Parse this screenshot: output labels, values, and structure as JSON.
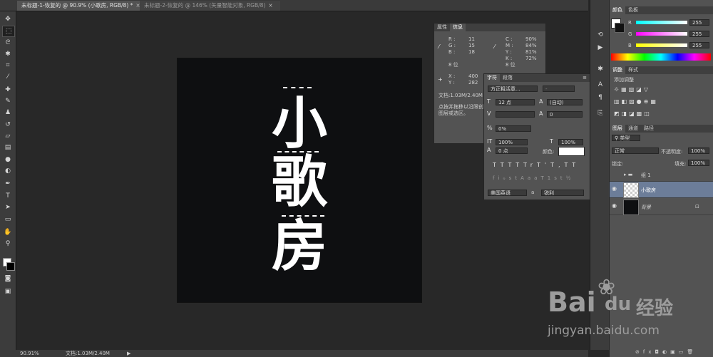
{
  "tabs": [
    {
      "label": "未标题-1-恢复的 @ 90.9% (小歌房, RGB/8) *",
      "close": "×"
    },
    {
      "label": "未标题-2-恢复的 @ 146% (矢量智能对象, RGB/8)",
      "close": "×"
    }
  ],
  "canvas_text": {
    "line1": "小",
    "line2": "歌",
    "line3": "房"
  },
  "status": {
    "zoom": "90.91%",
    "doc": "文档:1.03M/2.40M"
  },
  "info_panel": {
    "tabs": [
      "属性",
      "信息"
    ],
    "r_label": "R :",
    "r_val": "11",
    "g_label": "G :",
    "g_val": "15",
    "b_label": "B :",
    "b_val": "18",
    "c_label": "C :",
    "c_val": "90%",
    "m_label": "M :",
    "m_val": "84%",
    "y_label": "Y :",
    "y_val": "81%",
    "k_label": "K :",
    "k_val": "72%",
    "bits1": "8 位",
    "bits2": "8 位",
    "x_label": "X :",
    "x_val": "400",
    "y2_label": "Y :",
    "y2_val": "282",
    "doc": "文档:1.03M/2.40M",
    "hint": "点按并拖移以沿限创建图层或选区。"
  },
  "char_panel": {
    "tabs": [
      "字符",
      "段落"
    ],
    "font": "方正粗活意...",
    "style": "-",
    "size": "12 点",
    "leading": "(自动)",
    "tracking": "0",
    "scale_pct": "0%",
    "vscale": "100%",
    "hscale": "100%",
    "baseline": "0 点",
    "color_label": "颜色:",
    "lang": "美国英语",
    "aa_label": "a",
    "aa": "锐利",
    "glyphs1": [
      "T",
      "T",
      "TT",
      "Tr",
      "T'",
      "T,",
      "T",
      "T"
    ],
    "glyphs2": [
      "fi",
      "ℴ",
      "st",
      "A",
      "aa",
      "T",
      "1st",
      "½"
    ]
  },
  "color_panel": {
    "tabs": [
      "颜色",
      "色板"
    ],
    "r_label": "R",
    "r_val": "255",
    "g_label": "G",
    "g_val": "255",
    "b_label": "B",
    "b_val": "255"
  },
  "adjust_panel": {
    "tabs": [
      "调整",
      "样式"
    ],
    "title": "添加调整"
  },
  "layers_panel": {
    "tabs": [
      "图层",
      "通道",
      "路径"
    ],
    "kind": "类型",
    "blend": "正常",
    "opacity_label": "不透明度:",
    "opacity": "100%",
    "lock_label": "锁定:",
    "fill_label": "填充:",
    "fill": "100%",
    "layers": [
      {
        "name": "组 1",
        "type": "group"
      },
      {
        "name": "小歌房",
        "type": "text"
      },
      {
        "name": "背景",
        "type": "background"
      }
    ]
  },
  "watermark": {
    "brand": "Bai",
    "paw": "du",
    "cn": "经验",
    "url": "jingyan.baidu.com"
  },
  "colors": {
    "canvas": "#0e0f11",
    "selection": "#6c7d99"
  }
}
